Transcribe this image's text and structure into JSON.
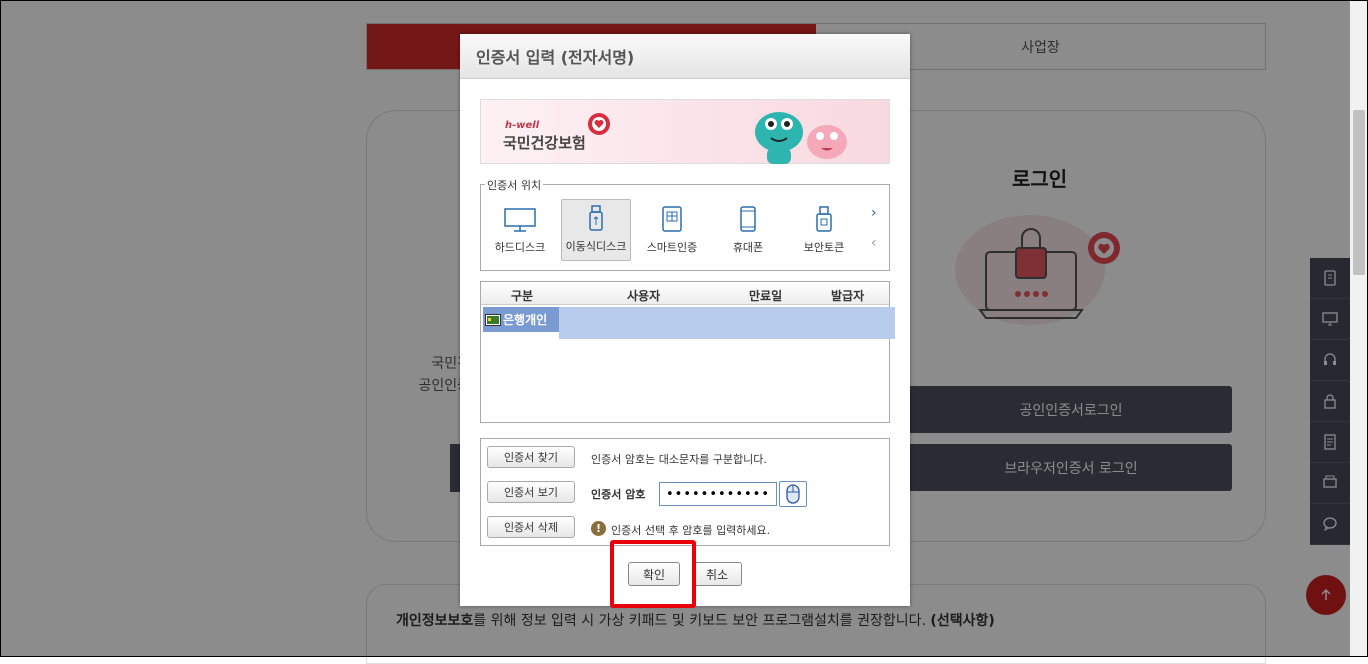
{
  "background": {
    "tabs": [
      {
        "label": ""
      },
      {
        "label": "사업장"
      }
    ],
    "left_text": [
      "국민건",
      "공인인증"
    ],
    "login_title": "로그인",
    "buttons": [
      {
        "label": "공인인증서로그인"
      },
      {
        "label": "브라우저인증서 로그인"
      }
    ],
    "privacy": {
      "bold_prefix": "개인정보보호",
      "text": "를 위해 정보 입력 시 가상 키패드 및 키보드 보안 프로그램설치를 권장합니다.",
      "bold_suffix": "(선택사항)"
    },
    "sidebar_icons": [
      "mobile-doc-icon",
      "monitor-person-icon",
      "headset-icon",
      "lock-icon",
      "document-icon",
      "printer-icon",
      "chat-icon"
    ]
  },
  "dialog": {
    "title": "인증서 입력 (전자서명)",
    "banner": {
      "brand_small": "h-well",
      "brand_main": "국민건강보험"
    },
    "location": {
      "legend": "인증서 위치",
      "items": [
        {
          "label": "하드디스크",
          "icon": "monitor-icon",
          "selected": false
        },
        {
          "label": "이동식디스크",
          "icon": "usb-icon",
          "selected": true
        },
        {
          "label": "스마트인증",
          "icon": "smartcard-icon",
          "selected": false
        },
        {
          "label": "휴대폰",
          "icon": "phone-icon",
          "selected": false
        },
        {
          "label": "보안토큰",
          "icon": "token-icon",
          "selected": false
        }
      ],
      "next": "›",
      "prev": "‹"
    },
    "cert_table": {
      "headers": [
        "구분",
        "사용자",
        "만료일",
        "발급자"
      ],
      "rows": [
        {
          "type": "은행개인",
          "user": "",
          "expiry": "",
          "issuer": ""
        }
      ]
    },
    "password": {
      "find_button": "인증서 찾기",
      "view_button": "인증서 보기",
      "delete_button": "인증서 삭제",
      "case_notice": "인증서 암호는 대소문자를 구분합니다.",
      "label": "인증서 암호",
      "value": "••••••••••••",
      "hint": "인증서 선택 후 암호를 입력하세요."
    },
    "confirm": "확인",
    "cancel": "취소"
  },
  "colors": {
    "accent_red": "#d32a2a",
    "highlight": "#e8000a",
    "dark_button": "#4e5060"
  }
}
